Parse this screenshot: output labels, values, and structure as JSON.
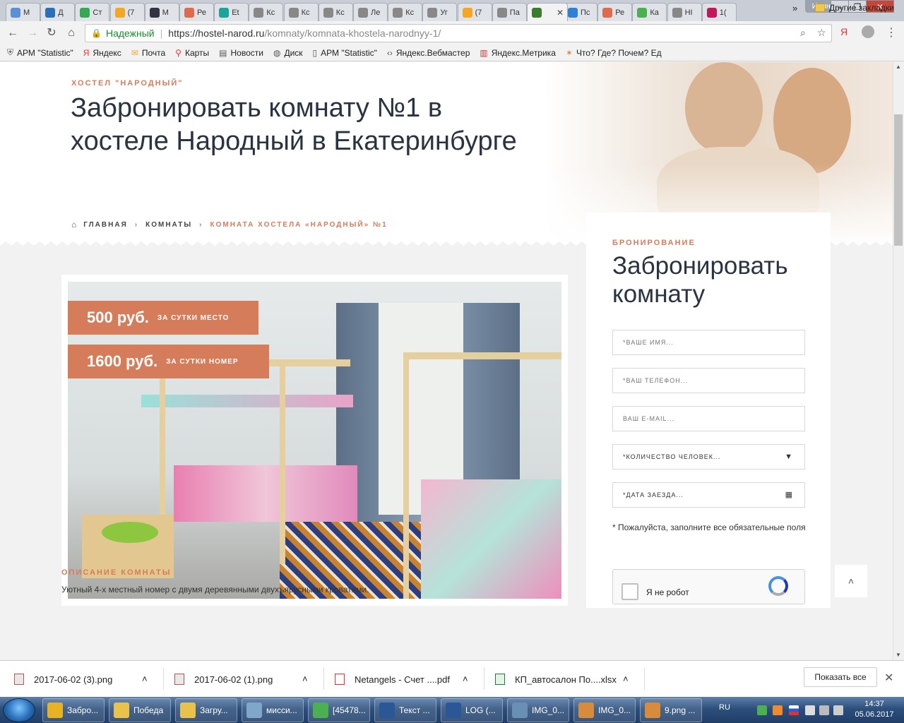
{
  "browser": {
    "tabs": [
      {
        "label": "М",
        "color": "#5b8fd6"
      },
      {
        "label": "Д",
        "color": "#2a6fb8"
      },
      {
        "label": "Ст",
        "color": "#34a853"
      },
      {
        "label": "(7",
        "color": "#f5a623"
      },
      {
        "label": "М",
        "color": "#334"
      },
      {
        "label": "Ре",
        "color": "#e06a4e"
      },
      {
        "label": "Et",
        "color": "#1aa59a"
      },
      {
        "label": "Кс",
        "color": "#888"
      },
      {
        "label": "Кс",
        "color": "#888"
      },
      {
        "label": "Кс",
        "color": "#888"
      },
      {
        "label": "Ле",
        "color": "#888"
      },
      {
        "label": "Кс",
        "color": "#888"
      },
      {
        "label": "Уг",
        "color": "#888"
      },
      {
        "label": "(7",
        "color": "#f5a623"
      },
      {
        "label": "Па",
        "color": "#888"
      },
      {
        "label": "",
        "color": "#3a7d2c",
        "active": true
      },
      {
        "label": "Пс",
        "color": "#2f7ed8"
      },
      {
        "label": "Ре",
        "color": "#e06a4e"
      },
      {
        "label": "Ка",
        "color": "#4caf50"
      },
      {
        "label": "НІ",
        "color": "#888"
      },
      {
        "label": "1(",
        "color": "#c2185b"
      }
    ],
    "profile": "Ирина",
    "secure_label": "Надежный",
    "url_host": "https://hostel-narod.ru",
    "url_path": "/komnaty/komnata-khostela-narodnyy-1/",
    "bookmarks": [
      {
        "label": "АРМ \"Statistic\"",
        "icon": "shield-icon"
      },
      {
        "label": "Яндекс",
        "icon": "yandex-icon"
      },
      {
        "label": "Почта",
        "icon": "mail-icon"
      },
      {
        "label": "Карты",
        "icon": "map-pin-icon"
      },
      {
        "label": "Новости",
        "icon": "news-icon"
      },
      {
        "label": "Диск",
        "icon": "disk-icon"
      },
      {
        "label": "АРМ \"Statistic\"",
        "icon": "page-icon"
      },
      {
        "label": "Яндекс.Вебмастер",
        "icon": "code-icon"
      },
      {
        "label": "Яндекс.Метрика",
        "icon": "chart-icon"
      },
      {
        "label": "Что? Где? Почем? Ед",
        "icon": "star-icon"
      }
    ],
    "bookmarks_more": "»",
    "other_bookmarks": "Другие закладки"
  },
  "hero": {
    "eyebrow": "ХОСТЕЛ \"НАРОДНЫЙ\"",
    "title": "Забронировать комнату №1 в хостеле Народный в Екатеринбурге",
    "breadcrumbs": {
      "home": "ГЛАВНАЯ",
      "rooms": "КОМНАТЫ",
      "current": "КОМНАТА ХОСТЕЛА «НАРОДНЫЙ» №1"
    }
  },
  "room": {
    "prices": [
      {
        "amount": "500 руб.",
        "unit": "ЗА СУТКИ МЕСТО"
      },
      {
        "amount": "1600 руб.",
        "unit": "ЗА СУТКИ НОМЕР"
      }
    ],
    "description_heading": "ОПИСАНИЕ КОМНАТЫ",
    "description": "Уютный 4-х местный номер с двумя деревянными двухъярусными  кроватями."
  },
  "booking": {
    "eyebrow": "БРОНИРОВАНИЕ",
    "title": "Забронировать комнату",
    "fields": {
      "name": "*ВАШЕ ИМЯ...",
      "phone": "*ВАШ ТЕЛЕФОН...",
      "email": "ВАШ E-MAIL...",
      "people": "*КОЛИЧЕСТВО ЧЕЛОВЕК...",
      "date": "*ДАТА ЗАЕЗДА..."
    },
    "note": "* Пожалуйста, заполните все обязательные поля",
    "captcha_label": "Я не робот"
  },
  "downloads": {
    "items": [
      {
        "name": "2017-06-02 (3).png",
        "type": "image"
      },
      {
        "name": "2017-06-02 (1).png",
        "type": "image"
      },
      {
        "name": "Netangels - Счет ....pdf",
        "type": "pdf"
      },
      {
        "name": "КП_автосалон По....xlsx",
        "type": "excel"
      }
    ],
    "show_all": "Показать все"
  },
  "taskbar": {
    "items": [
      {
        "label": "Забро...",
        "color": "#e8b323"
      },
      {
        "label": "Победа",
        "color": "#e8c24a"
      },
      {
        "label": "Загру...",
        "color": "#e8c24a"
      },
      {
        "label": "мисси...",
        "color": "#7fa7c9"
      },
      {
        "label": "[45478...",
        "color": "#4caf50"
      },
      {
        "label": "Текст ...",
        "color": "#2b5797"
      },
      {
        "label": "LOG (...",
        "color": "#2b5797"
      },
      {
        "label": "IMG_0...",
        "color": "#6a8fb5"
      },
      {
        "label": "IMG_0...",
        "color": "#d88b3a"
      },
      {
        "label": "9.png ...",
        "color": "#d88b3a"
      }
    ],
    "lang": "RU",
    "time": "14:37",
    "date": "05.06.2017"
  }
}
